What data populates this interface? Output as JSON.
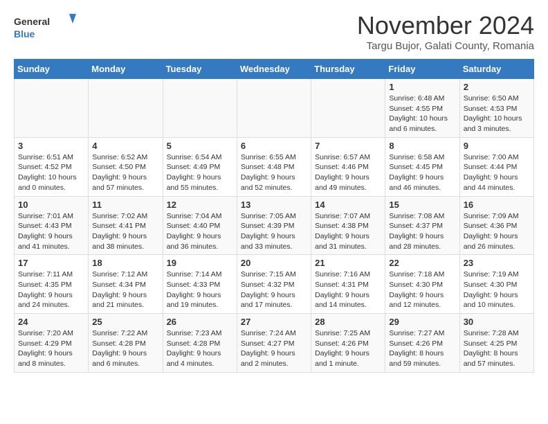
{
  "logo": {
    "text_general": "General",
    "text_blue": "Blue"
  },
  "header": {
    "month": "November 2024",
    "location": "Targu Bujor, Galati County, Romania"
  },
  "weekdays": [
    "Sunday",
    "Monday",
    "Tuesday",
    "Wednesday",
    "Thursday",
    "Friday",
    "Saturday"
  ],
  "weeks": [
    [
      {
        "day": "",
        "info": ""
      },
      {
        "day": "",
        "info": ""
      },
      {
        "day": "",
        "info": ""
      },
      {
        "day": "",
        "info": ""
      },
      {
        "day": "",
        "info": ""
      },
      {
        "day": "1",
        "info": "Sunrise: 6:48 AM\nSunset: 4:55 PM\nDaylight: 10 hours and 6 minutes."
      },
      {
        "day": "2",
        "info": "Sunrise: 6:50 AM\nSunset: 4:53 PM\nDaylight: 10 hours and 3 minutes."
      }
    ],
    [
      {
        "day": "3",
        "info": "Sunrise: 6:51 AM\nSunset: 4:52 PM\nDaylight: 10 hours and 0 minutes."
      },
      {
        "day": "4",
        "info": "Sunrise: 6:52 AM\nSunset: 4:50 PM\nDaylight: 9 hours and 57 minutes."
      },
      {
        "day": "5",
        "info": "Sunrise: 6:54 AM\nSunset: 4:49 PM\nDaylight: 9 hours and 55 minutes."
      },
      {
        "day": "6",
        "info": "Sunrise: 6:55 AM\nSunset: 4:48 PM\nDaylight: 9 hours and 52 minutes."
      },
      {
        "day": "7",
        "info": "Sunrise: 6:57 AM\nSunset: 4:46 PM\nDaylight: 9 hours and 49 minutes."
      },
      {
        "day": "8",
        "info": "Sunrise: 6:58 AM\nSunset: 4:45 PM\nDaylight: 9 hours and 46 minutes."
      },
      {
        "day": "9",
        "info": "Sunrise: 7:00 AM\nSunset: 4:44 PM\nDaylight: 9 hours and 44 minutes."
      }
    ],
    [
      {
        "day": "10",
        "info": "Sunrise: 7:01 AM\nSunset: 4:43 PM\nDaylight: 9 hours and 41 minutes."
      },
      {
        "day": "11",
        "info": "Sunrise: 7:02 AM\nSunset: 4:41 PM\nDaylight: 9 hours and 38 minutes."
      },
      {
        "day": "12",
        "info": "Sunrise: 7:04 AM\nSunset: 4:40 PM\nDaylight: 9 hours and 36 minutes."
      },
      {
        "day": "13",
        "info": "Sunrise: 7:05 AM\nSunset: 4:39 PM\nDaylight: 9 hours and 33 minutes."
      },
      {
        "day": "14",
        "info": "Sunrise: 7:07 AM\nSunset: 4:38 PM\nDaylight: 9 hours and 31 minutes."
      },
      {
        "day": "15",
        "info": "Sunrise: 7:08 AM\nSunset: 4:37 PM\nDaylight: 9 hours and 28 minutes."
      },
      {
        "day": "16",
        "info": "Sunrise: 7:09 AM\nSunset: 4:36 PM\nDaylight: 9 hours and 26 minutes."
      }
    ],
    [
      {
        "day": "17",
        "info": "Sunrise: 7:11 AM\nSunset: 4:35 PM\nDaylight: 9 hours and 24 minutes."
      },
      {
        "day": "18",
        "info": "Sunrise: 7:12 AM\nSunset: 4:34 PM\nDaylight: 9 hours and 21 minutes."
      },
      {
        "day": "19",
        "info": "Sunrise: 7:14 AM\nSunset: 4:33 PM\nDaylight: 9 hours and 19 minutes."
      },
      {
        "day": "20",
        "info": "Sunrise: 7:15 AM\nSunset: 4:32 PM\nDaylight: 9 hours and 17 minutes."
      },
      {
        "day": "21",
        "info": "Sunrise: 7:16 AM\nSunset: 4:31 PM\nDaylight: 9 hours and 14 minutes."
      },
      {
        "day": "22",
        "info": "Sunrise: 7:18 AM\nSunset: 4:30 PM\nDaylight: 9 hours and 12 minutes."
      },
      {
        "day": "23",
        "info": "Sunrise: 7:19 AM\nSunset: 4:30 PM\nDaylight: 9 hours and 10 minutes."
      }
    ],
    [
      {
        "day": "24",
        "info": "Sunrise: 7:20 AM\nSunset: 4:29 PM\nDaylight: 9 hours and 8 minutes."
      },
      {
        "day": "25",
        "info": "Sunrise: 7:22 AM\nSunset: 4:28 PM\nDaylight: 9 hours and 6 minutes."
      },
      {
        "day": "26",
        "info": "Sunrise: 7:23 AM\nSunset: 4:28 PM\nDaylight: 9 hours and 4 minutes."
      },
      {
        "day": "27",
        "info": "Sunrise: 7:24 AM\nSunset: 4:27 PM\nDaylight: 9 hours and 2 minutes."
      },
      {
        "day": "28",
        "info": "Sunrise: 7:25 AM\nSunset: 4:26 PM\nDaylight: 9 hours and 1 minute."
      },
      {
        "day": "29",
        "info": "Sunrise: 7:27 AM\nSunset: 4:26 PM\nDaylight: 8 hours and 59 minutes."
      },
      {
        "day": "30",
        "info": "Sunrise: 7:28 AM\nSunset: 4:25 PM\nDaylight: 8 hours and 57 minutes."
      }
    ]
  ]
}
